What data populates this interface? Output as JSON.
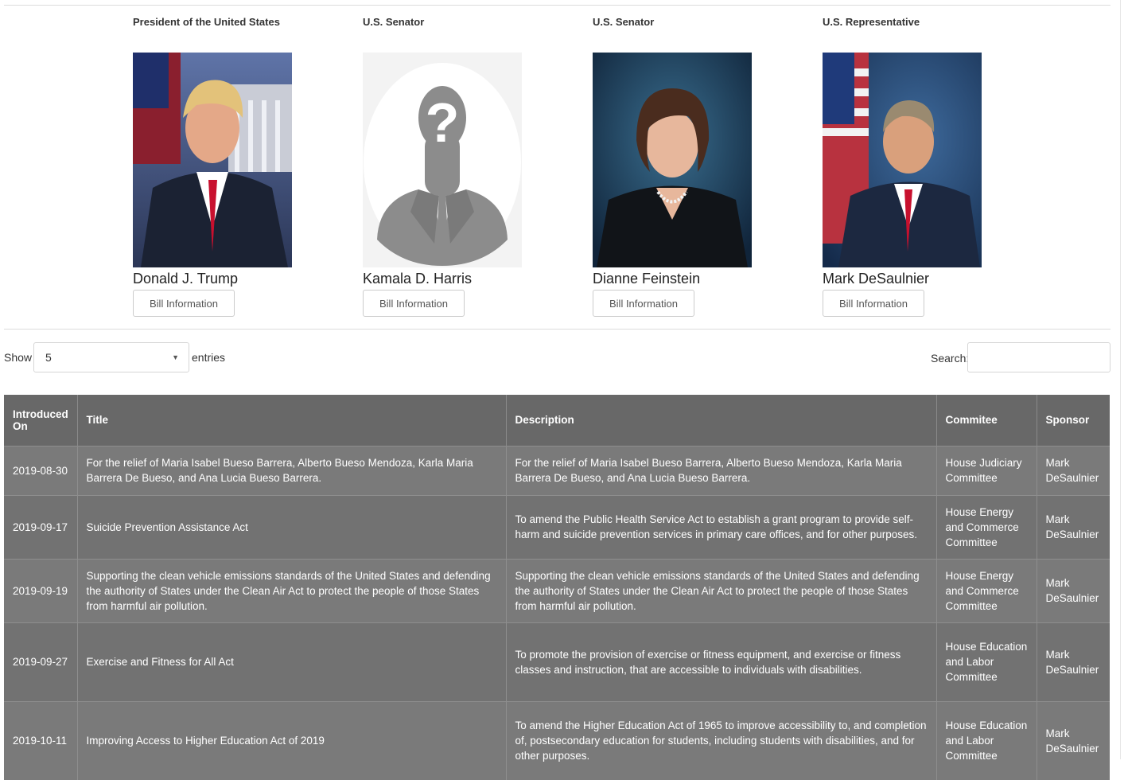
{
  "officials": [
    {
      "role": "President of the United States",
      "name": "Donald J. Trump",
      "button": "Bill Information"
    },
    {
      "role": "U.S. Senator",
      "name": "Kamala D. Harris",
      "button": "Bill Information"
    },
    {
      "role": "U.S. Senator",
      "name": "Dianne Feinstein",
      "button": "Bill Information"
    },
    {
      "role": "U.S. Representative",
      "name": "Mark DeSaulnier",
      "button": "Bill Information"
    }
  ],
  "table_controls": {
    "show_label": "Show",
    "page_size": "5",
    "entries_label": "entries",
    "search_label": "Search:",
    "search_value": ""
  },
  "table": {
    "headers": [
      "Introduced On",
      "Title",
      "Description",
      "Commitee",
      "Sponsor"
    ],
    "rows": [
      {
        "introduced": "2019-08-30",
        "title": "For the relief of Maria Isabel Bueso Barrera, Alberto Bueso Mendoza, Karla Maria Barrera De Bueso, and Ana Lucia Bueso Barrera.",
        "description": "For the relief of Maria Isabel Bueso Barrera, Alberto Bueso Mendoza, Karla Maria Barrera De Bueso, and Ana Lucia Bueso Barrera.",
        "committee": "House Judiciary Committee",
        "sponsor": "Mark DeSaulnier"
      },
      {
        "introduced": "2019-09-17",
        "title": "Suicide Prevention Assistance Act",
        "description": "To amend the Public Health Service Act to establish a grant program to provide self-harm and suicide prevention services in primary care offices, and for other purposes.",
        "committee": "House Energy and Commerce Committee",
        "sponsor": "Mark DeSaulnier"
      },
      {
        "introduced": "2019-09-19",
        "title": "Supporting the clean vehicle emissions standards of the United States and defending the authority of States under the Clean Air Act to protect the people of those States from harmful air pollution.",
        "description": "Supporting the clean vehicle emissions standards of the United States and defending the authority of States under the Clean Air Act to protect the people of those States from harmful air pollution.",
        "committee": "House Energy and Commerce Committee",
        "sponsor": "Mark DeSaulnier"
      },
      {
        "introduced": "2019-09-27",
        "title": "Exercise and Fitness for All Act",
        "description": "To promote the provision of exercise or fitness equipment, and exercise or fitness classes and instruction, that are accessible to individuals with disabilities.",
        "committee": "House Education and Labor Committee",
        "sponsor": "Mark DeSaulnier"
      },
      {
        "introduced": "2019-10-11",
        "title": "Improving Access to Higher Education Act of 2019",
        "description": "To amend the Higher Education Act of 1965 to improve accessibility to, and completion of, postsecondary education for students, including students with disabilities, and for other purposes.",
        "committee": "House Education and Labor Committee",
        "sponsor": "Mark DeSaulnier"
      }
    ]
  }
}
